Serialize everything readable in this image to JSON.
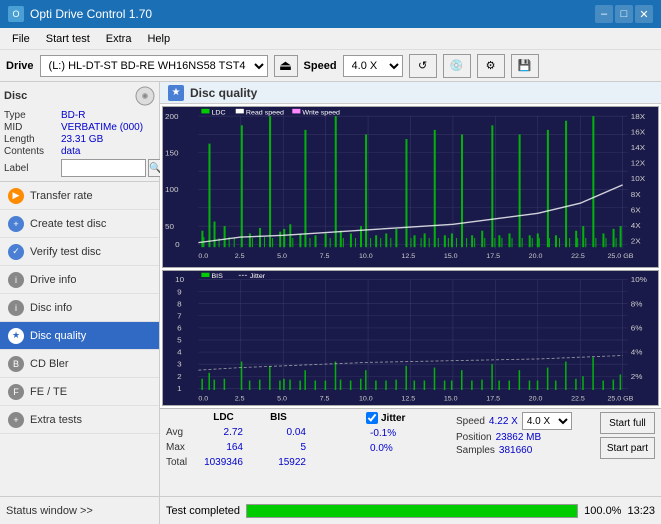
{
  "titleBar": {
    "title": "Opti Drive Control 1.70",
    "minimizeLabel": "–",
    "maximizeLabel": "□",
    "closeLabel": "✕"
  },
  "menuBar": {
    "items": [
      "File",
      "Start test",
      "Extra",
      "Help"
    ]
  },
  "driveBar": {
    "driveLabel": "Drive",
    "driveValue": "(L:) HL-DT-ST BD-RE  WH16NS58 TST4",
    "speedLabel": "Speed",
    "speedValue": "4.0 X"
  },
  "sidebar": {
    "discTitle": "Disc",
    "discInfo": {
      "typeLabel": "Type",
      "typeValue": "BD-R",
      "midLabel": "MID",
      "midValue": "VERBATIMe (000)",
      "lengthLabel": "Length",
      "lengthValue": "23.31 GB",
      "contentsLabel": "Contents",
      "contentsValue": "data",
      "labelLabel": "Label"
    },
    "navItems": [
      {
        "id": "transfer-rate",
        "label": "Transfer rate",
        "iconType": "orange"
      },
      {
        "id": "create-test-disc",
        "label": "Create test disc",
        "iconType": "blue"
      },
      {
        "id": "verify-test-disc",
        "label": "Verify test disc",
        "iconType": "blue"
      },
      {
        "id": "drive-info",
        "label": "Drive info",
        "iconType": "gray"
      },
      {
        "id": "disc-info",
        "label": "Disc info",
        "iconType": "gray"
      },
      {
        "id": "disc-quality",
        "label": "Disc quality",
        "iconType": "blue",
        "active": true
      },
      {
        "id": "cd-bler",
        "label": "CD Bler",
        "iconType": "gray"
      },
      {
        "id": "fe-te",
        "label": "FE / TE",
        "iconType": "gray"
      },
      {
        "id": "extra-tests",
        "label": "Extra tests",
        "iconType": "gray"
      }
    ],
    "statusWindow": "Status window >>"
  },
  "content": {
    "title": "Disc quality",
    "chart1": {
      "legend": [
        "LDC",
        "Read speed",
        "Write speed"
      ],
      "yAxisMax": 200,
      "yAxisRight": [
        "18X",
        "16X",
        "14X",
        "12X",
        "10X",
        "8X",
        "6X",
        "4X",
        "2X"
      ],
      "xAxisLabels": [
        "0.0",
        "2.5",
        "5.0",
        "7.5",
        "10.0",
        "12.5",
        "15.0",
        "17.5",
        "20.0",
        "22.5",
        "25.0 GB"
      ]
    },
    "chart2": {
      "legend": [
        "BIS",
        "Jitter"
      ],
      "yAxisLeft": [
        "10",
        "9",
        "8",
        "7",
        "6",
        "5",
        "4",
        "3",
        "2",
        "1"
      ],
      "yAxisRight": [
        "10%",
        "8%",
        "6%",
        "4%",
        "2%"
      ],
      "xAxisLabels": [
        "0.0",
        "2.5",
        "5.0",
        "7.5",
        "10.0",
        "12.5",
        "15.0",
        "17.5",
        "20.0",
        "22.5",
        "25.0 GB"
      ]
    }
  },
  "stats": {
    "ldcHeader": "LDC",
    "bisHeader": "BIS",
    "jitterHeader": "Jitter",
    "avgLabel": "Avg",
    "maxLabel": "Max",
    "totalLabel": "Total",
    "ldcAvg": "2.72",
    "ldcMax": "164",
    "ldcTotal": "1039346",
    "bisAvg": "0.04",
    "bisMax": "5",
    "bisTotal": "15922",
    "jitterChecked": true,
    "jitterLabel": "Jitter",
    "jitterAvg": "-0.1%",
    "jitterMax": "0.0%",
    "speedLabel": "Speed",
    "speedValue": "4.22 X",
    "speedDropdown": "4.0 X",
    "positionLabel": "Position",
    "positionValue": "23862 MB",
    "samplesLabel": "Samples",
    "samplesValue": "381660",
    "startFullLabel": "Start full",
    "startPartLabel": "Start part"
  },
  "bottomStatus": {
    "statusText": "Test completed",
    "progressPercent": 100,
    "progressLabel": "100.0%",
    "timeLabel": "13:23"
  }
}
